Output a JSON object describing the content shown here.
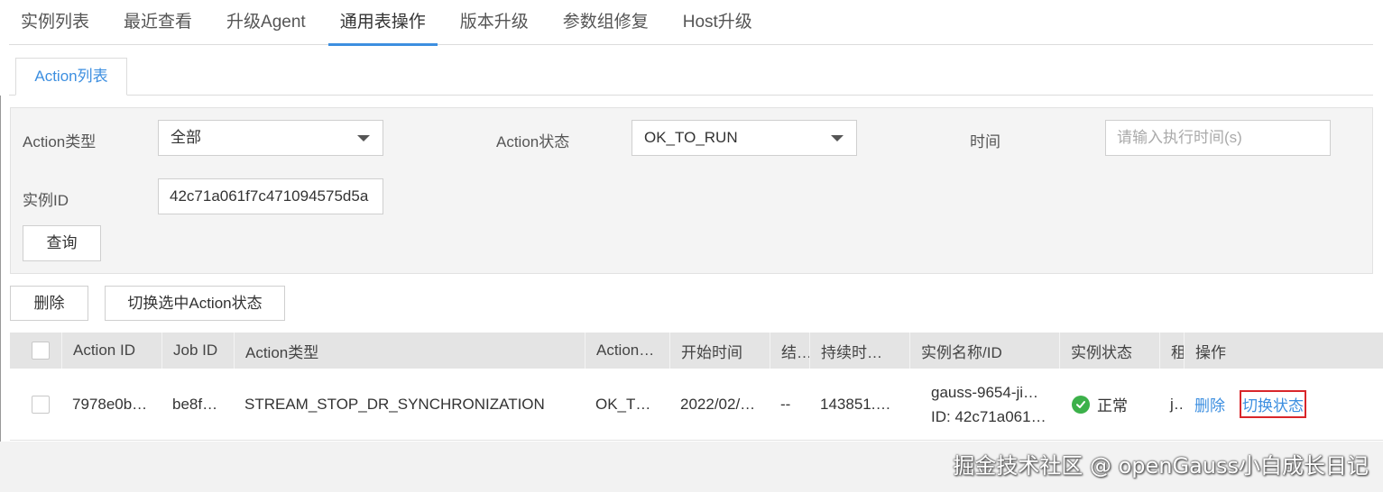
{
  "top_tabs": [
    "实例列表",
    "最近查看",
    "升级Agent",
    "通用表操作",
    "版本升级",
    "参数组修复",
    "Host升级"
  ],
  "active_top_tab": "通用表操作",
  "sub_tab": "Action列表",
  "filters": {
    "action_type_label": "Action类型",
    "action_type_value": "全部",
    "action_status_label": "Action状态",
    "action_status_value": "OK_TO_RUN",
    "time_label": "时间",
    "time_placeholder": "请输入执行时间(s)",
    "instance_id_label": "实例ID",
    "instance_id_value": "42c71a061f7c471094575d5a",
    "query_button": "查询"
  },
  "toolbar": {
    "delete_button": "删除",
    "switch_button": "切换选中Action状态"
  },
  "table": {
    "headers": {
      "action_id": "Action ID",
      "job_id": "Job ID",
      "action_type": "Action类型",
      "action_status": "Action…",
      "start_time": "开始时间",
      "result": "结…",
      "duration": "持续时…",
      "instance": "实例名称/ID",
      "instance_status": "实例状态",
      "tenant": "租",
      "ops": "操作"
    },
    "rows": [
      {
        "action_id": "7978e0b…",
        "job_id": "be8f…",
        "action_type": "STREAM_STOP_DR_SYNCHRONIZATION",
        "action_status": "OK_T…",
        "start_time": "2022/02/…",
        "result": "--",
        "duration": "143851.…",
        "instance_name": "gauss-9654-ji…",
        "instance_id": "ID: 42c71a061…",
        "instance_status": "正常",
        "tenant": "j…",
        "op_delete": "删除",
        "op_switch": "切换状态"
      }
    ]
  },
  "colors": {
    "accent": "#3d8fe0",
    "success": "#3cb14a",
    "highlight_box": "#d9262a"
  },
  "watermark": "掘金技术社区 @ openGauss小白成长日记"
}
